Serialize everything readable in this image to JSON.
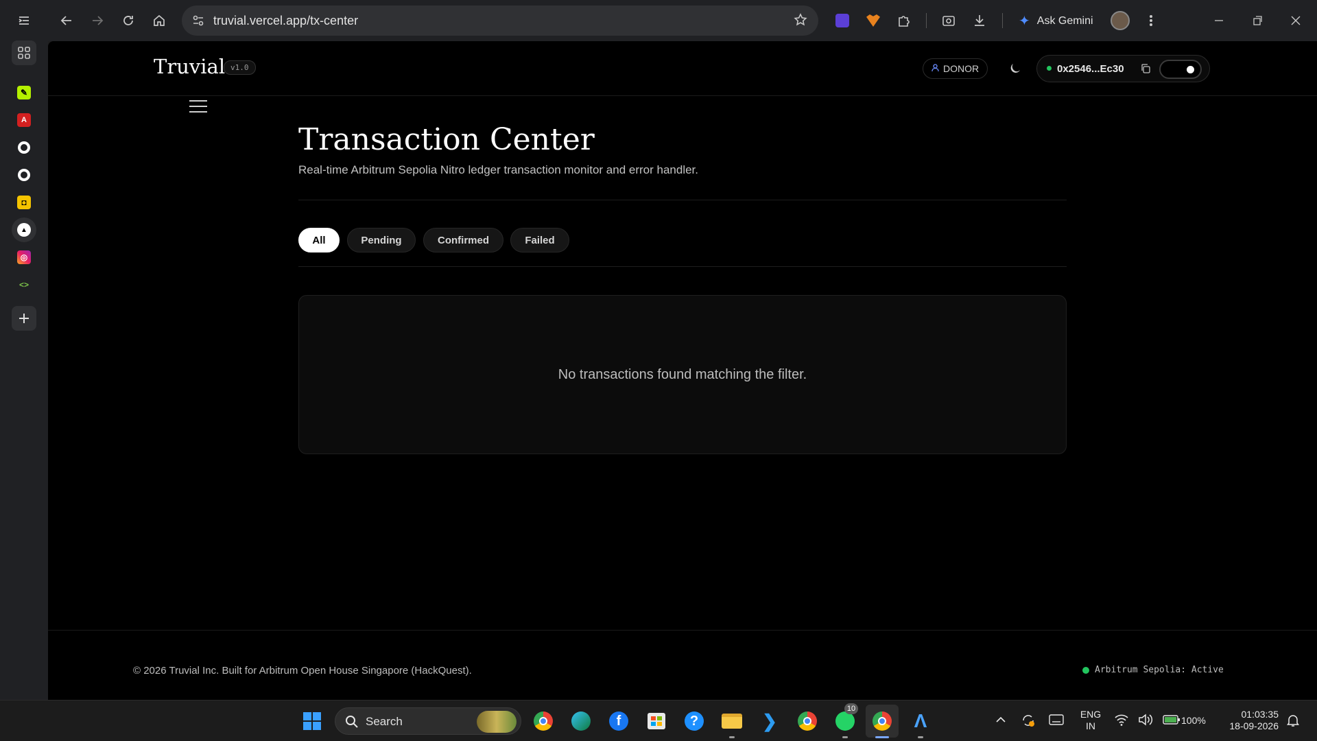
{
  "browser": {
    "url": "truvial.vercel.app/tx-center",
    "ask_gemini_label": "Ask Gemini"
  },
  "header": {
    "brand": "Truvial",
    "version": "v1.0",
    "role_badge": "DONOR",
    "wallet_address": "0x2546...Ec30"
  },
  "main": {
    "title": "Transaction Center",
    "subtitle": "Real-time Arbitrum Sepolia Nitro ledger transaction monitor and error handler.",
    "filters": [
      {
        "label": "All",
        "active": true
      },
      {
        "label": "Pending",
        "active": false
      },
      {
        "label": "Confirmed",
        "active": false
      },
      {
        "label": "Failed",
        "active": false
      }
    ],
    "empty_message": "No transactions found matching the filter."
  },
  "footer": {
    "copyright": "© 2026 Truvial Inc. Built for Arbitrum Open House Singapore (HackQuest).",
    "network_status": "Arbitrum Sepolia: Active"
  },
  "taskbar": {
    "search_placeholder": "Search",
    "whatsapp_badge": "10",
    "language": "ENG",
    "region": "IN",
    "battery": "100%",
    "time": "01:03:35",
    "date": "18-09-2026"
  },
  "colors": {
    "accent_green": "#22c55e",
    "page_bg": "#000000",
    "chrome_bg": "#202124"
  }
}
